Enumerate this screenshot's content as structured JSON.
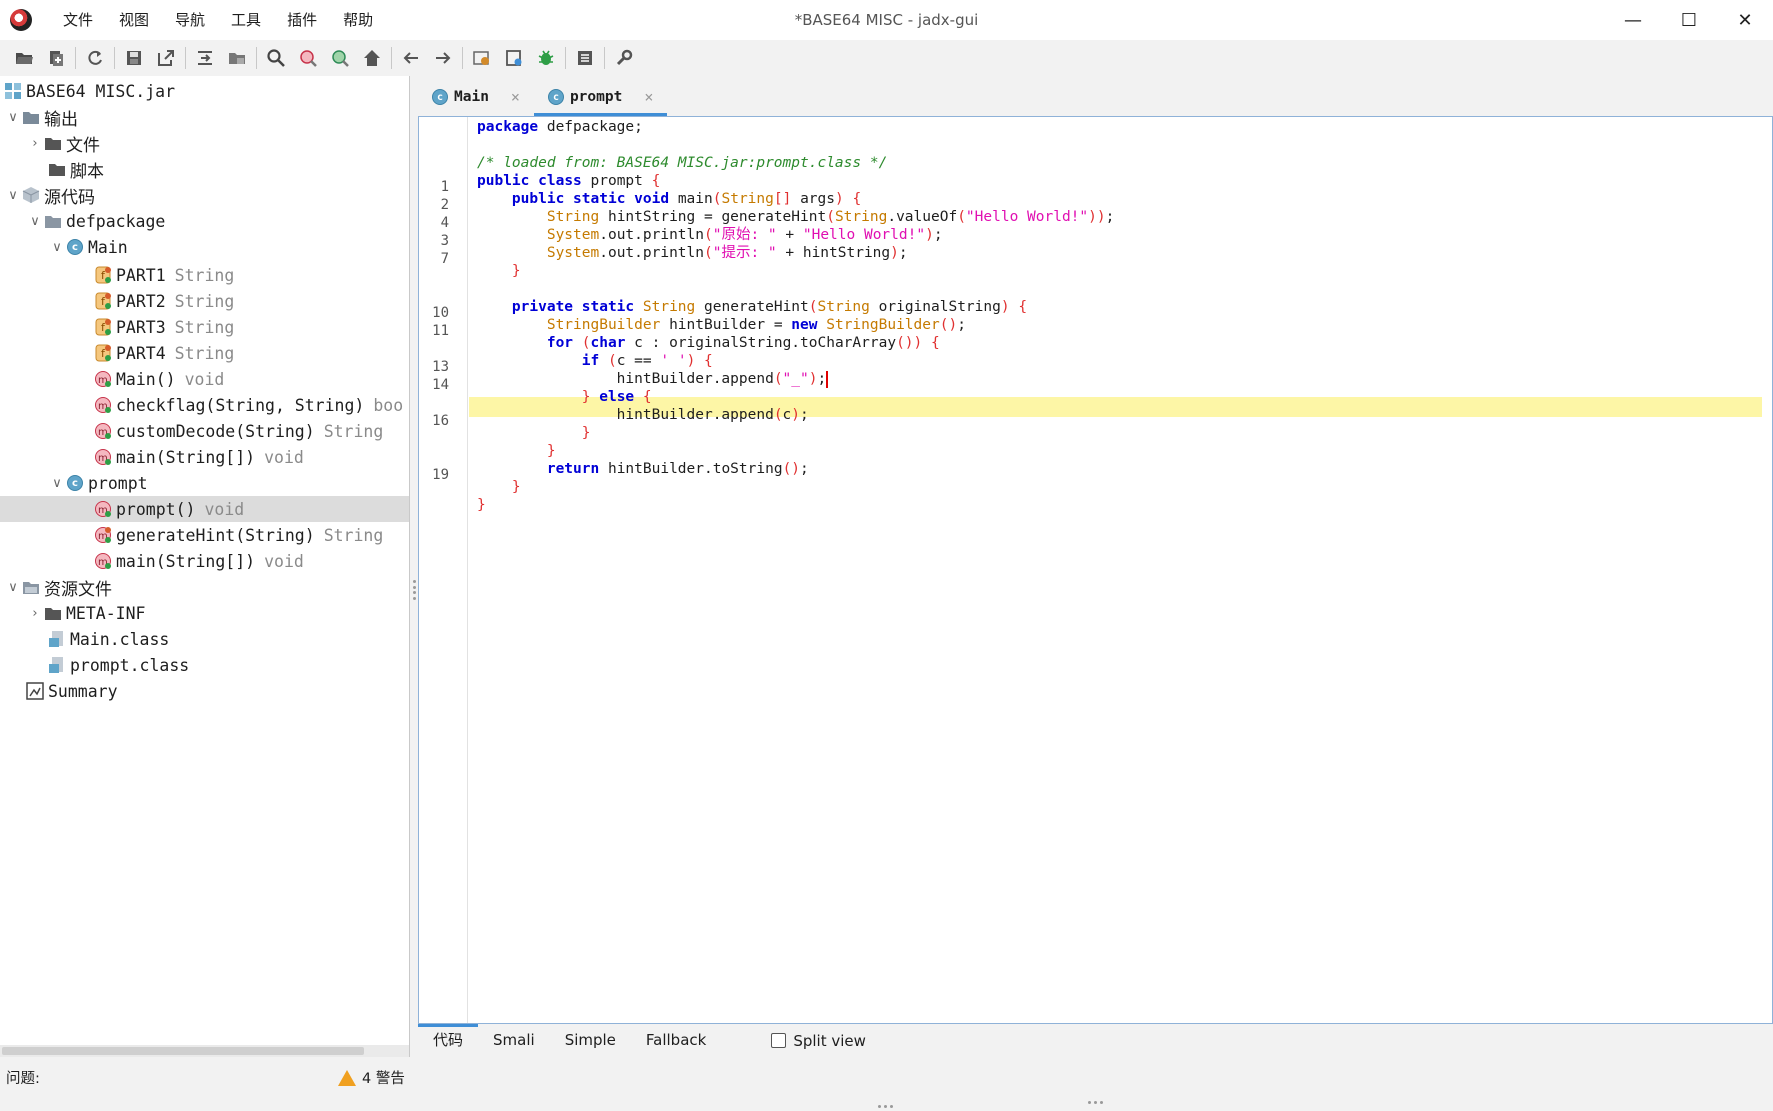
{
  "window": {
    "title": "*BASE64 MISC - jadx-gui",
    "minimize": "—",
    "maximize": "☐",
    "close": "✕"
  },
  "menu": [
    "文件",
    "视图",
    "导航",
    "工具",
    "插件",
    "帮助"
  ],
  "toolbar_icons": [
    "open-file-icon",
    "add-files-icon",
    "reload-icon",
    "save-icon",
    "export-icon",
    "sync-tree-icon",
    "flatten-packages-icon",
    "search-icon",
    "find-class-icon",
    "find-usage-icon",
    "home-icon",
    "back-arrow-icon",
    "forward-arrow-icon",
    "deobfuscation-icon",
    "quark-icon",
    "debug-icon",
    "log-icon",
    "preferences-icon"
  ],
  "tree": {
    "jar": "BASE64 MISC.jar",
    "output": "输出",
    "files": "文件",
    "scripts": "脚本",
    "source_code": "源代码",
    "package": "defpackage",
    "main_class": "Main",
    "main_members": [
      {
        "name": "PART1",
        "type": "String",
        "kind": "field"
      },
      {
        "name": "PART2",
        "type": "String",
        "kind": "field"
      },
      {
        "name": "PART3",
        "type": "String",
        "kind": "field"
      },
      {
        "name": "PART4",
        "type": "String",
        "kind": "field"
      },
      {
        "name": "Main()",
        "type": "void",
        "kind": "method"
      },
      {
        "name": "checkflag(String, String)",
        "type": "boo",
        "kind": "method"
      },
      {
        "name": "customDecode(String)",
        "type": "String",
        "kind": "method"
      },
      {
        "name": "main(String[])",
        "type": "void",
        "kind": "method"
      }
    ],
    "prompt_class": "prompt",
    "prompt_members": [
      {
        "name": "prompt()",
        "type": "void",
        "kind": "method"
      },
      {
        "name": "generateHint(String)",
        "type": "String",
        "kind": "method"
      },
      {
        "name": "main(String[])",
        "type": "void",
        "kind": "method"
      }
    ],
    "resources": "资源文件",
    "meta_inf": "META-INF",
    "main_class_file": "Main.class",
    "prompt_class_file": "prompt.class",
    "summary": "Summary"
  },
  "tabs": [
    {
      "label": "Main",
      "close": "×"
    },
    {
      "label": "prompt",
      "close": "×"
    }
  ],
  "editor": {
    "line_numbers": [
      "",
      "",
      "",
      "1",
      "2",
      "4",
      "3",
      "7",
      "",
      "",
      "10",
      "11",
      "",
      "13",
      "14",
      "",
      "16",
      "",
      "",
      "19",
      "",
      ""
    ]
  },
  "bottom_tabs": [
    "代码",
    "Smali",
    "Simple",
    "Fallback"
  ],
  "split_view": "Split view",
  "status": {
    "problems": "问题:",
    "warnings": "4 警告"
  }
}
